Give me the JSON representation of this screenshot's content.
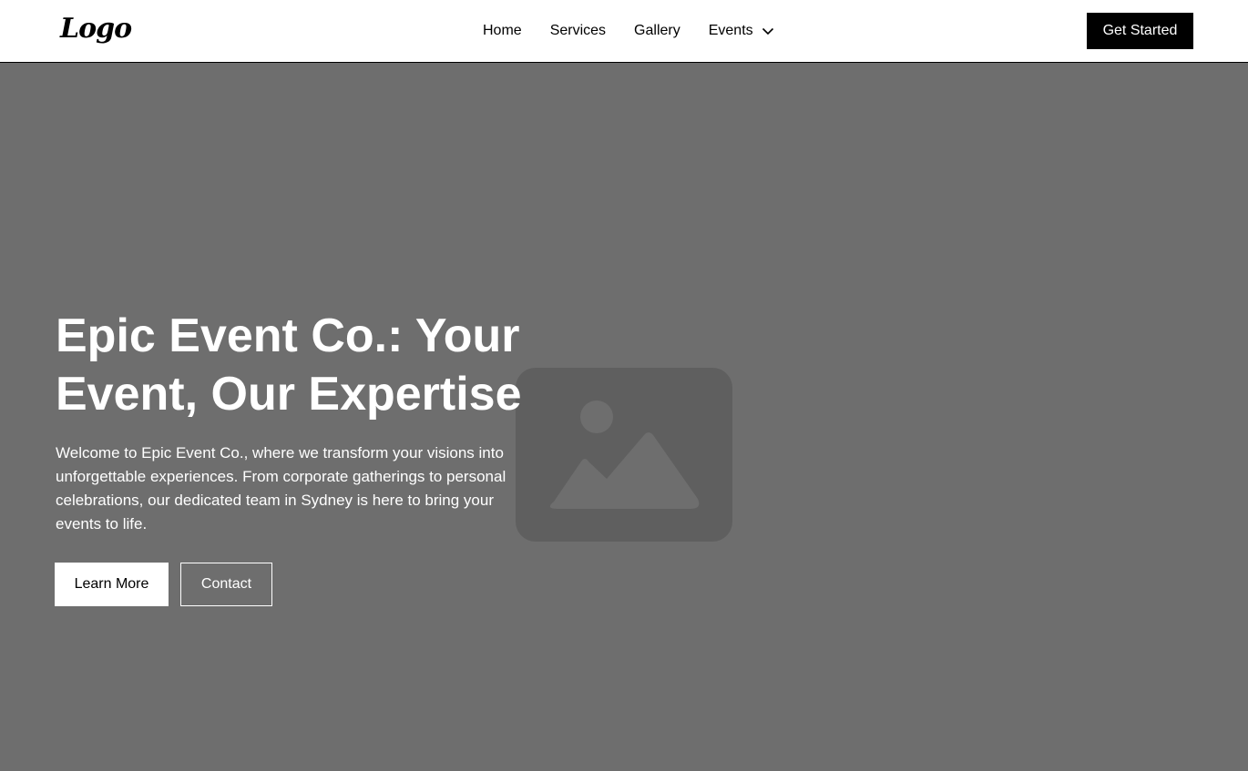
{
  "header": {
    "logo_text": "Logo",
    "nav": {
      "home": "Home",
      "services": "Services",
      "gallery": "Gallery",
      "events": "Events"
    },
    "cta_label": "Get Started"
  },
  "hero": {
    "title": "Epic Event Co.: Your Event, Our Expertise",
    "description": "Welcome to Epic Event Co., where we transform your visions into unforgettable experiences. From corporate gatherings to personal celebrations, our dedicated team in Sydney is here to bring your events to life.",
    "primary_button": "Learn More",
    "secondary_button": "Contact",
    "image_icon": "image-placeholder-icon"
  },
  "colors": {
    "hero_background": "#6e6e6e",
    "primary": "#000000",
    "on_primary": "#ffffff"
  }
}
